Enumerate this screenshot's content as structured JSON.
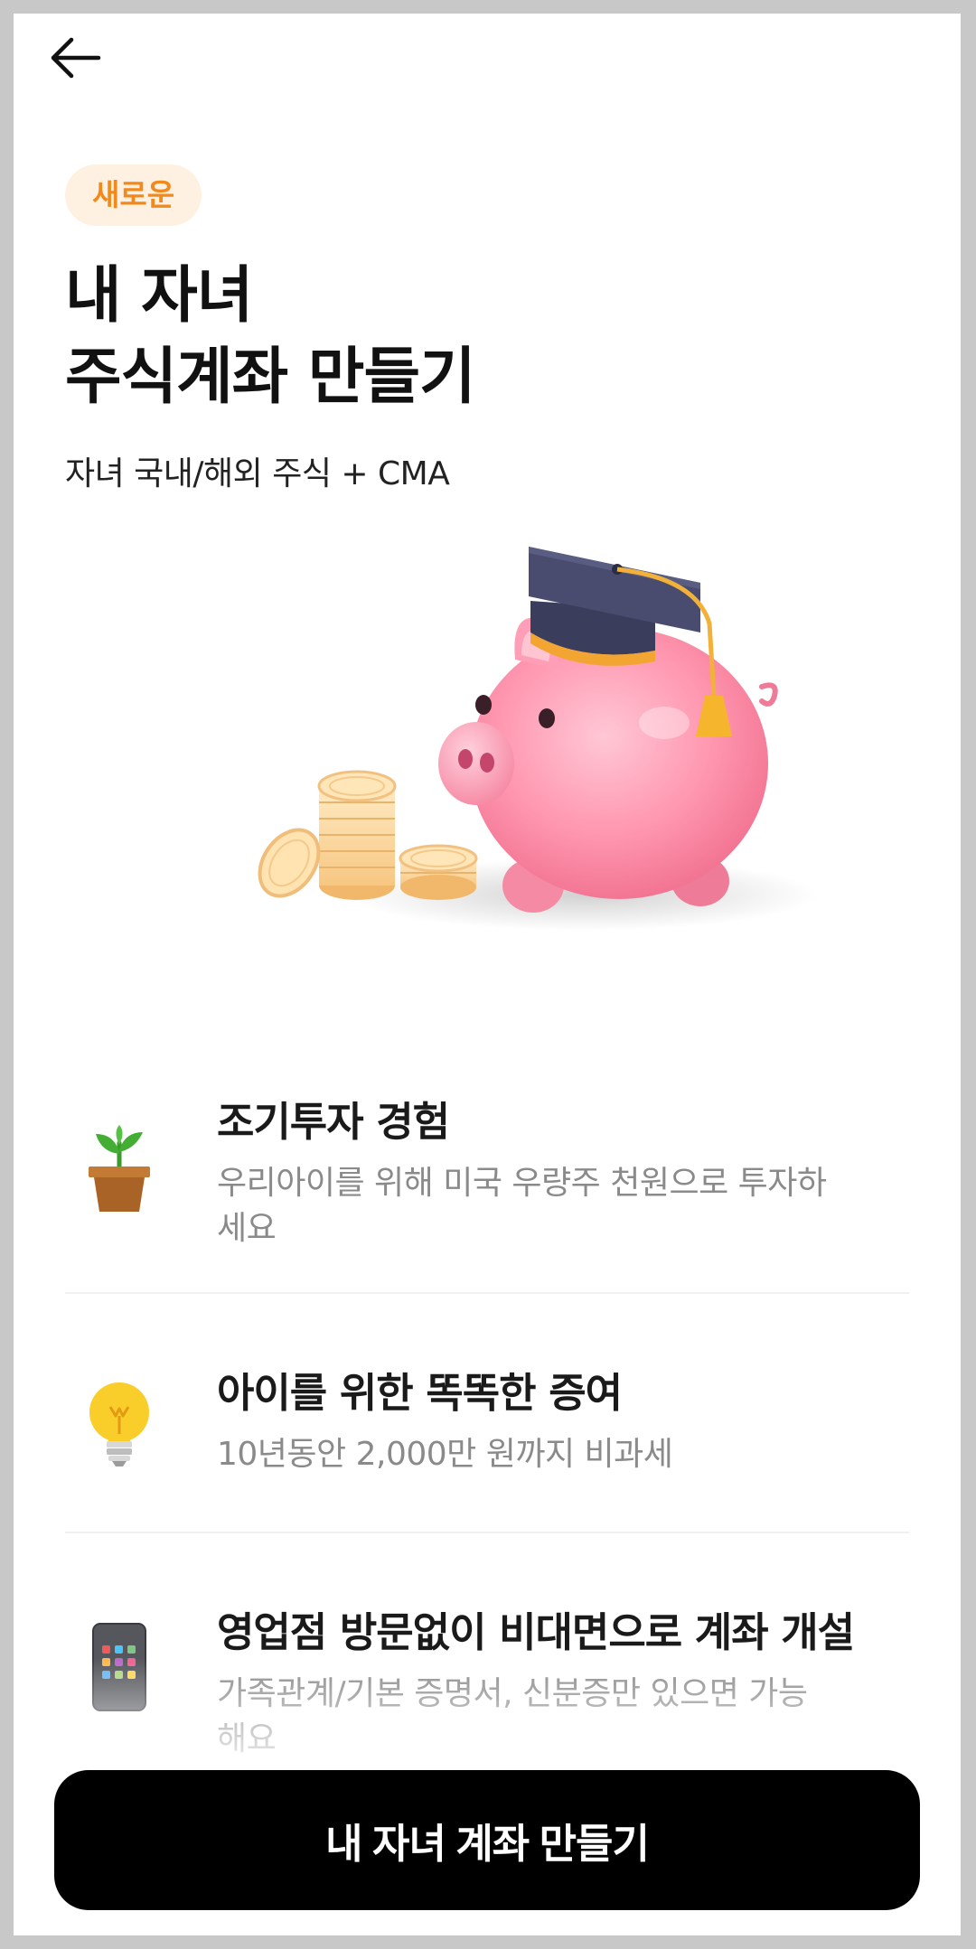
{
  "header": {
    "back_icon": "arrow-left-icon"
  },
  "badge": {
    "label": "새로운",
    "color": "#f2891c",
    "background": "#fff1e2"
  },
  "title": {
    "line1": "내 자녀",
    "line2": "주식계좌 만들기"
  },
  "subtitle": "자녀 국내/해외 주식 + CMA",
  "hero": {
    "icon": "piggy-bank-graduation-cap-illustration"
  },
  "features": [
    {
      "icon": "potted-plant-icon",
      "title": "조기투자 경험",
      "description": "우리아이를 위해 미국 우량주 천원으로 투자하세요"
    },
    {
      "icon": "lightbulb-icon",
      "title": "아이를 위한 똑똑한 증여",
      "description": "10년동안 2,000만 원까지 비과세"
    },
    {
      "icon": "smartphone-icon",
      "title": "영업점 방문없이 비대면으로 계좌 개설",
      "description": "가족관계/기본 증명서, 신분증만 있으면 가능해요"
    }
  ],
  "cta": {
    "label": "내 자녀 계좌 만들기",
    "background": "#000000"
  }
}
